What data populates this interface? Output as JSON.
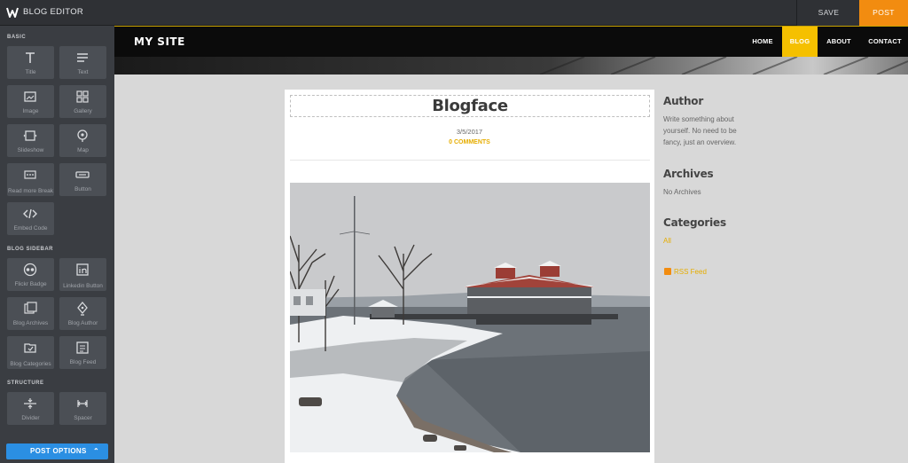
{
  "editor": {
    "title": "BLOG EDITOR",
    "save_label": "SAVE",
    "post_label": "POST",
    "accent": "#f28c10"
  },
  "sidebar": {
    "sections": {
      "basic": "BASIC",
      "blog_sidebar": "BLOG SIDEBAR",
      "structure": "STRUCTURE"
    },
    "basic_tiles": [
      {
        "label": "Title",
        "icon": "title-icon"
      },
      {
        "label": "Text",
        "icon": "text-icon"
      },
      {
        "label": "Image",
        "icon": "image-icon"
      },
      {
        "label": "Gallery",
        "icon": "gallery-icon"
      },
      {
        "label": "Slideshow",
        "icon": "slideshow-icon"
      },
      {
        "label": "Map",
        "icon": "map-icon"
      },
      {
        "label": "Read more Break",
        "icon": "read-more-icon"
      },
      {
        "label": "Button",
        "icon": "button-icon"
      },
      {
        "label": "Embed Code",
        "icon": "embed-code-icon"
      }
    ],
    "blog_tiles": [
      {
        "label": "Flickr Badge",
        "icon": "flickr-icon"
      },
      {
        "label": "Linkedin Button",
        "icon": "linkedin-icon"
      },
      {
        "label": "Blog Archives",
        "icon": "archives-icon"
      },
      {
        "label": "Blog Author",
        "icon": "author-icon"
      },
      {
        "label": "Blog Categories",
        "icon": "categories-icon"
      },
      {
        "label": "Blog Feed",
        "icon": "feed-icon"
      }
    ],
    "structure_tiles": [
      {
        "label": "Divider",
        "icon": "divider-icon"
      },
      {
        "label": "Spacer",
        "icon": "spacer-icon"
      }
    ],
    "post_options_label": "POST OPTIONS",
    "post_options_color": "#2b8fe3"
  },
  "site": {
    "title": "MY SITE",
    "nav": [
      "HOME",
      "BLOG",
      "ABOUT",
      "CONTACT"
    ],
    "active_nav": "BLOG",
    "active_color": "#f5c000"
  },
  "post": {
    "title": "Blogface",
    "date": "3/5/2017",
    "comments": "0 COMMENTS"
  },
  "widgets": {
    "author_title": "Author",
    "author_text": "Write something about yourself. No need to be fancy, just an overview.",
    "archives_title": "Archives",
    "archives_text": "No Archives",
    "categories_title": "Categories",
    "categories_link": "All",
    "rss_label": "RSS Feed"
  }
}
